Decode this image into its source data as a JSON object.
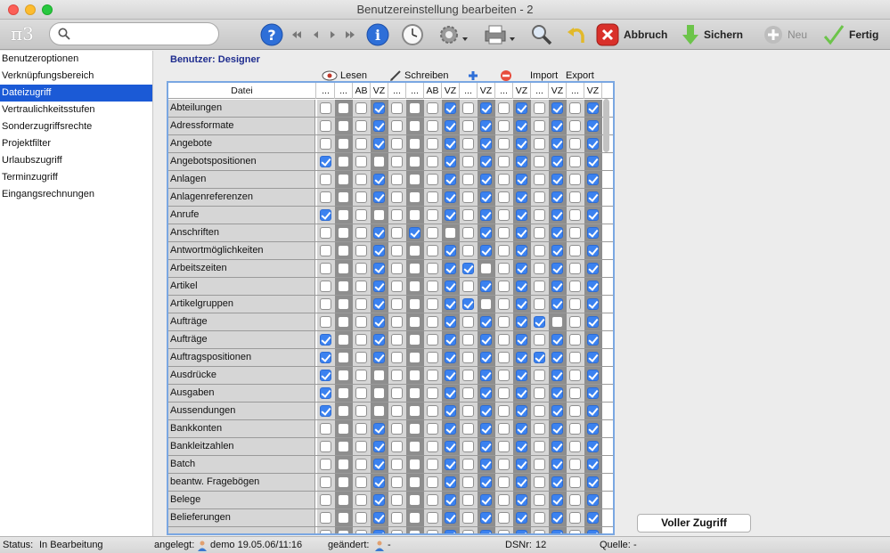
{
  "window": {
    "title": "Benutzereinstellung bearbeiten - 2"
  },
  "toolbar": {
    "logo": "π3",
    "search_placeholder": "",
    "abort_label": "Abbruch",
    "save_label": "Sichern",
    "new_label": "Neu",
    "done_label": "Fertig"
  },
  "sidebar": {
    "items": [
      {
        "label": "Benutzeroptionen",
        "active": false
      },
      {
        "label": "Verknüpfungsbereich",
        "active": false
      },
      {
        "label": "Dateizugriff",
        "active": true
      },
      {
        "label": "Vertraulichkeitsstufen",
        "active": false
      },
      {
        "label": "Sonderzugriffsrechte",
        "active": false
      },
      {
        "label": "Projektfilter",
        "active": false
      },
      {
        "label": "Urlaubszugriff",
        "active": false
      },
      {
        "label": "Terminzugriff",
        "active": false
      },
      {
        "label": "Eingangsrechnungen",
        "active": false
      }
    ]
  },
  "main": {
    "user_label": "Benutzer: Designer",
    "groups": {
      "read": "Lesen",
      "write": "Schreiben",
      "import": "Import",
      "export": "Export"
    },
    "column_header_file": "Datei",
    "column_headers": [
      "...",
      "...",
      "AB",
      "VZ",
      "...",
      "...",
      "AB",
      "VZ",
      "...",
      "VZ",
      "...",
      "VZ",
      "...",
      "VZ",
      "...",
      "VZ"
    ],
    "rows": [
      {
        "name": "Abteilungen",
        "checks": [
          0,
          0,
          0,
          1,
          0,
          0,
          0,
          1,
          0,
          1,
          0,
          1,
          0,
          1,
          0,
          1
        ]
      },
      {
        "name": "Adressformate",
        "checks": [
          0,
          0,
          0,
          1,
          0,
          0,
          0,
          1,
          0,
          1,
          0,
          1,
          0,
          1,
          0,
          1
        ]
      },
      {
        "name": "Angebote",
        "checks": [
          0,
          0,
          0,
          1,
          0,
          0,
          0,
          1,
          0,
          1,
          0,
          1,
          0,
          1,
          0,
          1
        ]
      },
      {
        "name": "Angebotspositionen",
        "checks": [
          1,
          0,
          0,
          0,
          0,
          0,
          0,
          1,
          0,
          1,
          0,
          1,
          0,
          1,
          0,
          1
        ]
      },
      {
        "name": "Anlagen",
        "checks": [
          0,
          0,
          0,
          1,
          0,
          0,
          0,
          1,
          0,
          1,
          0,
          1,
          0,
          1,
          0,
          1
        ]
      },
      {
        "name": "Anlagenreferenzen",
        "checks": [
          0,
          0,
          0,
          1,
          0,
          0,
          0,
          1,
          0,
          1,
          0,
          1,
          0,
          1,
          0,
          1
        ]
      },
      {
        "name": "Anrufe",
        "checks": [
          1,
          0,
          0,
          0,
          0,
          0,
          0,
          1,
          0,
          1,
          0,
          1,
          0,
          1,
          0,
          1
        ]
      },
      {
        "name": "Anschriften",
        "checks": [
          0,
          0,
          0,
          1,
          0,
          1,
          0,
          0,
          0,
          1,
          0,
          1,
          0,
          1,
          0,
          1
        ]
      },
      {
        "name": "Antwortmöglichkeiten",
        "checks": [
          0,
          0,
          0,
          1,
          0,
          0,
          0,
          1,
          0,
          1,
          0,
          1,
          0,
          1,
          0,
          1
        ]
      },
      {
        "name": "Arbeitszeiten",
        "checks": [
          0,
          0,
          0,
          1,
          0,
          0,
          0,
          1,
          1,
          0,
          0,
          1,
          0,
          1,
          0,
          1
        ]
      },
      {
        "name": "Artikel",
        "checks": [
          0,
          0,
          0,
          1,
          0,
          0,
          0,
          1,
          0,
          1,
          0,
          1,
          0,
          1,
          0,
          1
        ]
      },
      {
        "name": "Artikelgruppen",
        "checks": [
          0,
          0,
          0,
          1,
          0,
          0,
          0,
          1,
          1,
          0,
          0,
          1,
          0,
          1,
          0,
          1
        ]
      },
      {
        "name": "Aufträge",
        "checks": [
          0,
          0,
          0,
          1,
          0,
          0,
          0,
          1,
          0,
          1,
          0,
          1,
          1,
          0,
          0,
          1
        ]
      },
      {
        "name": "Aufträge",
        "checks": [
          1,
          0,
          0,
          1,
          0,
          0,
          0,
          1,
          0,
          1,
          0,
          1,
          0,
          1,
          0,
          1
        ]
      },
      {
        "name": "Auftragspositionen",
        "checks": [
          1,
          0,
          0,
          1,
          0,
          0,
          0,
          1,
          0,
          1,
          0,
          1,
          1,
          1,
          0,
          1
        ]
      },
      {
        "name": "Ausdrücke",
        "checks": [
          1,
          0,
          0,
          0,
          0,
          0,
          0,
          1,
          0,
          1,
          0,
          1,
          0,
          1,
          0,
          1
        ]
      },
      {
        "name": "Ausgaben",
        "checks": [
          1,
          0,
          0,
          0,
          0,
          0,
          0,
          1,
          0,
          1,
          0,
          1,
          0,
          1,
          0,
          1
        ]
      },
      {
        "name": "Aussendungen",
        "checks": [
          1,
          0,
          0,
          0,
          0,
          0,
          0,
          1,
          0,
          1,
          0,
          1,
          0,
          1,
          0,
          1
        ]
      },
      {
        "name": "Bankkonten",
        "checks": [
          0,
          0,
          0,
          1,
          0,
          0,
          0,
          1,
          0,
          1,
          0,
          1,
          0,
          1,
          0,
          1
        ]
      },
      {
        "name": "Bankleitzahlen",
        "checks": [
          0,
          0,
          0,
          1,
          0,
          0,
          0,
          1,
          0,
          1,
          0,
          1,
          0,
          1,
          0,
          1
        ]
      },
      {
        "name": "Batch",
        "checks": [
          0,
          0,
          0,
          1,
          0,
          0,
          0,
          1,
          0,
          1,
          0,
          1,
          0,
          1,
          0,
          1
        ]
      },
      {
        "name": "beantw. Fragebögen",
        "checks": [
          0,
          0,
          0,
          1,
          0,
          0,
          0,
          1,
          0,
          1,
          0,
          1,
          0,
          1,
          0,
          1
        ]
      },
      {
        "name": "Belege",
        "checks": [
          0,
          0,
          0,
          1,
          0,
          0,
          0,
          1,
          0,
          1,
          0,
          1,
          0,
          1,
          0,
          1
        ]
      },
      {
        "name": "Belieferungen",
        "checks": [
          0,
          0,
          0,
          1,
          0,
          0,
          0,
          1,
          0,
          1,
          0,
          1,
          0,
          1,
          0,
          1
        ]
      },
      {
        "name": "",
        "checks": [
          0,
          0,
          0,
          1,
          0,
          0,
          0,
          1,
          0,
          1,
          0,
          1,
          0,
          1,
          0,
          1
        ]
      }
    ],
    "full_access_button": "Voller Zugriff"
  },
  "status": {
    "status_label": "Status:",
    "status_value": "In Bearbeitung",
    "created_label": "angelegt:",
    "created_value": "demo 19.05.06/11:16",
    "changed_label": "geändert:",
    "changed_value": "-",
    "dsnr_label": "DSNr:",
    "dsnr_value": "12",
    "source_label": "Quelle:",
    "source_value": "-"
  }
}
